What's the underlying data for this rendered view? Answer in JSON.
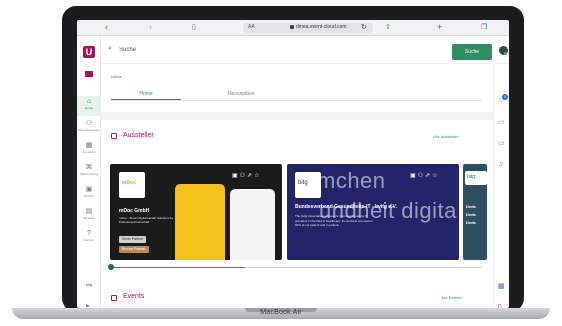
{
  "device": {
    "model_label": "MacBook Air"
  },
  "browser": {
    "text_size_label": "AA",
    "url": "dmea.event-cloud.com",
    "icons": [
      "chevron-left-icon",
      "chevron-right-icon",
      "book-icon",
      "share-icon",
      "plus-icon",
      "tabs-icon",
      "reload-icon",
      "lock-icon"
    ]
  },
  "app": {
    "logo_letter": "U",
    "brand_color": "#a8145a",
    "accent_color": "#2f8f63"
  },
  "sidebar": {
    "items": [
      {
        "label": "Home",
        "icon": "home-icon",
        "active": true
      },
      {
        "label": "Mein Ecosystem",
        "icon": "people-icon",
        "active": false
      },
      {
        "label": "Aussteller",
        "icon": "building-icon",
        "active": false
      },
      {
        "label": "Matchmaking",
        "icon": "network-icon",
        "active": false
      },
      {
        "label": "Events",
        "icon": "calendar-icon",
        "active": false
      },
      {
        "label": "Merkliste",
        "icon": "bookmark-icon",
        "active": false
      },
      {
        "label": "Support",
        "icon": "help-icon",
        "active": false
      }
    ],
    "brand_text": "bitg"
  },
  "header": {
    "search_placeholder": "Suche",
    "search_button": "Suche"
  },
  "right_sidebar": {
    "notification_count": "0",
    "icons": [
      "contacts-icon",
      "chat-icon",
      "tickets-icon",
      "bell-icon",
      "calendar-icon",
      "device-icon"
    ]
  },
  "main": {
    "breadcrumb": "Home",
    "tabs": [
      {
        "label": "Home",
        "active": true
      },
      {
        "label": "Messepläne",
        "active": false
      }
    ],
    "exhibitors": {
      "title": "Aussteller",
      "link": "Alle Aussteller",
      "cards": [
        {
          "logo_text": "mDoc",
          "name": "mDoc GmbH",
          "description": "mDoc - Smart Digital Health Solutions by Patientenpartnerschaft",
          "pill": "Silver Partner",
          "secondary_label": "Bronze Partner"
        },
        {
          "logo_text": "bitg",
          "headline": "Bundesverband Gesundheits-IT - bvitg e.V.",
          "description": "The bvitg Association represents Germany's leading IT providers in the field of healthcare. Its products are used in 90% of our patient and in-patient...",
          "bg_words": [
            "mchen",
            "undheit digita"
          ]
        },
        {
          "logo_text": "bitg",
          "text_lines": [
            "Deda",
            "Deda",
            "Deda"
          ]
        }
      ],
      "progress": 0.36
    },
    "events": {
      "title": "Events",
      "link": "Alle Events"
    }
  }
}
